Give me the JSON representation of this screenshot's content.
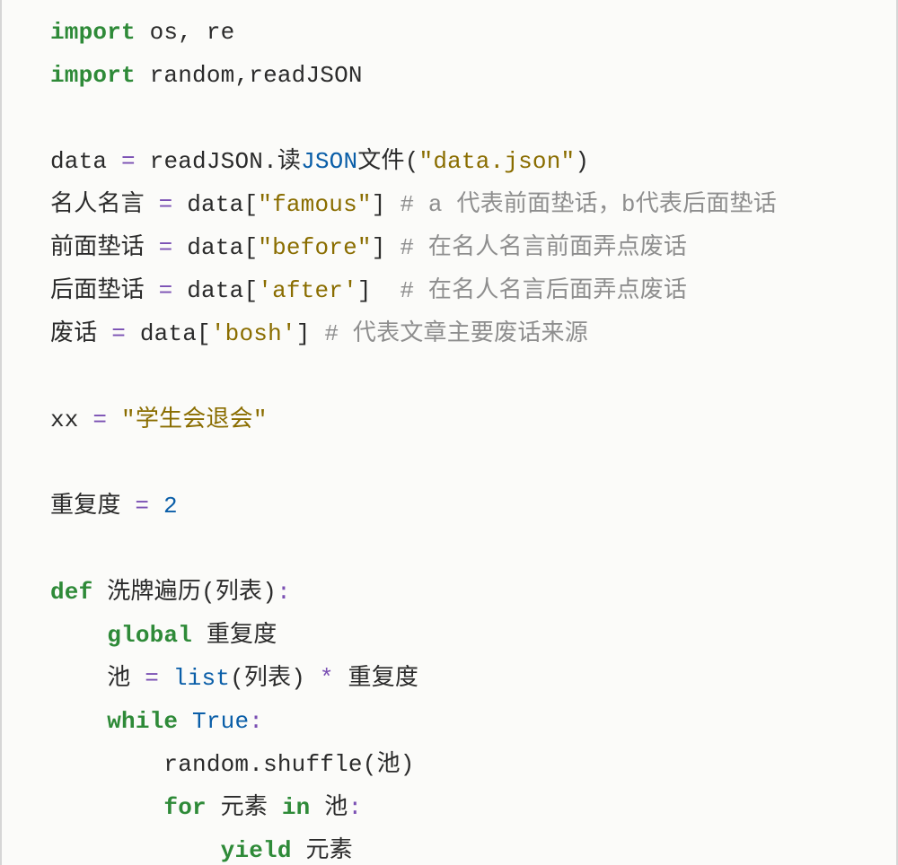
{
  "code": {
    "lines": [
      {
        "type": "import1",
        "kw": "import",
        "rest_a": " os",
        "comma": ",",
        "rest_b": " re"
      },
      {
        "type": "import2",
        "kw": "import",
        "rest_a": " random",
        "comma": ",",
        "rest_b": "readJSON"
      },
      {
        "type": "blank"
      },
      {
        "type": "assign_call",
        "lhs": "data",
        "eq": " = ",
        "obj": "readJSON",
        "dot": ".",
        "m_pre": "读",
        "m_hl": "JSON",
        "m_post": "文件",
        "paren_o": "(",
        "arg": "\"data.json\"",
        "paren_c": ")"
      },
      {
        "type": "assign_index_cmt",
        "lhs": "名人名言",
        "eq": " = ",
        "obj": "data",
        "idx": "[\"famous\"]",
        "sp": " ",
        "cmt": "# a 代表前面垫话，b代表后面垫话"
      },
      {
        "type": "assign_index_cmt",
        "lhs": "前面垫话",
        "eq": " = ",
        "obj": "data",
        "idx": "[\"before\"]",
        "sp": " ",
        "cmt": "# 在名人名言前面弄点废话"
      },
      {
        "type": "assign_index_cmt",
        "lhs": "后面垫话",
        "eq": " = ",
        "obj": "data",
        "idx": "['after']",
        "sp": "  ",
        "cmt": "# 在名人名言后面弄点废话"
      },
      {
        "type": "assign_index_cmt",
        "lhs": "废话",
        "eq": " = ",
        "obj": "data",
        "idx": "['bosh']",
        "sp": " ",
        "cmt": "# 代表文章主要废话来源"
      },
      {
        "type": "blank"
      },
      {
        "type": "assign_str",
        "lhs": "xx",
        "eq": " = ",
        "str": "\"学生会退会\""
      },
      {
        "type": "blank"
      },
      {
        "type": "assign_num",
        "lhs": "重复度",
        "eq": " = ",
        "num": "2"
      },
      {
        "type": "blank"
      },
      {
        "type": "def",
        "kw": "def",
        "sp": " ",
        "name": "洗牌遍历",
        "sig": "(列表)",
        "colon": ":"
      },
      {
        "type": "global",
        "indent": "    ",
        "kw": "global",
        "sp": " ",
        "name": "重复度"
      },
      {
        "type": "pool",
        "indent": "    ",
        "lhs": "池",
        "eq": " = ",
        "fn": "list",
        "args": "(列表)",
        "sp1": " ",
        "op": "*",
        "sp2": " ",
        "rhs": "重复度"
      },
      {
        "type": "while",
        "indent": "    ",
        "kw": "while",
        "sp": " ",
        "val": "True",
        "colon": ":"
      },
      {
        "type": "call",
        "indent": "        ",
        "obj": "random",
        "dot": ".",
        "m": "shuffle",
        "args": "(池)"
      },
      {
        "type": "for",
        "indent": "        ",
        "kw": "for",
        "sp1": " ",
        "var": "元素",
        "sp2": " ",
        "kw2": "in",
        "sp3": " ",
        "iter": "池",
        "colon": ":"
      },
      {
        "type": "yield",
        "indent": "            ",
        "kw": "yield",
        "sp": " ",
        "val": "元素"
      }
    ]
  }
}
